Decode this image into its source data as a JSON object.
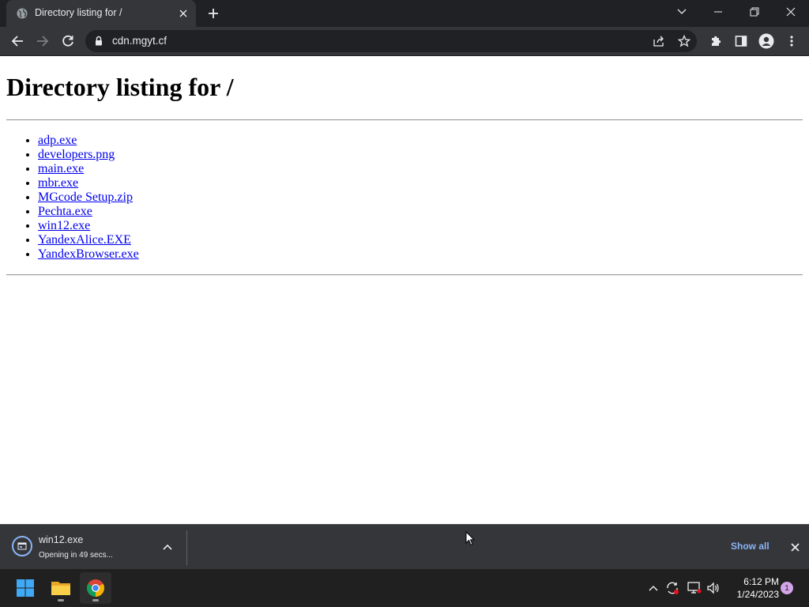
{
  "browser": {
    "tab": {
      "title": "Directory listing for /"
    },
    "address": {
      "url": "cdn.mgyt.cf"
    }
  },
  "page": {
    "heading": "Directory listing for /",
    "files": [
      "adp.exe",
      "developers.png",
      "main.exe",
      "mbr.exe",
      "MGcode Setup.zip",
      "Pechta.exe",
      "win12.exe",
      "YandexAlice.EXE",
      "YandexBrowser.exe"
    ]
  },
  "download_shelf": {
    "file_name": "win12.exe",
    "status": "Opening in 49 secs...",
    "show_all_label": "Show all"
  },
  "taskbar": {
    "time": "6:12 PM",
    "date": "1/24/2023",
    "notification_count": "1"
  },
  "colors": {
    "link": "#0000ee",
    "accent": "#8ab4f8",
    "toolbar": "#35363a",
    "titlebar": "#202124"
  }
}
